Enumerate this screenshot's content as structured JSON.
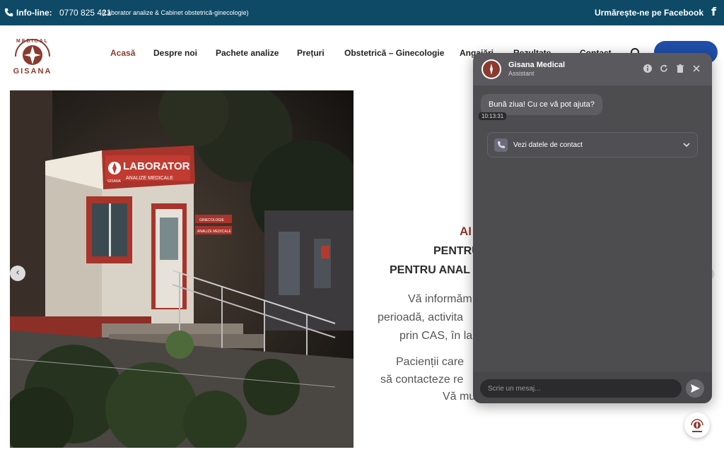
{
  "topbar": {
    "info_label": "Info-line:",
    "phone": "0770 825 421",
    "description": "(Laborator analize & Cabinet obstetrică-ginecologie)",
    "follow": "Urmărește-ne pe Facebook",
    "fb_glyph": "f"
  },
  "logo": {
    "top_text": "MEDICAL",
    "brand": "GISANA"
  },
  "nav": {
    "home": "Acasă",
    "about": "Despre noi",
    "packages": "Pachete analize",
    "prices": "Prețuri",
    "obstetrics": "Obstetrică – Ginecologie",
    "jobs": "Angajări",
    "results": "Rezultate",
    "contact": "Contact"
  },
  "hero": {
    "sign_main": "LABORATOR",
    "sign_sub": "ANALIZE MEDICALE",
    "sign_brand": "GISANA",
    "door_sign_1": "GINECOLOGIE",
    "door_sign_2": "ANALIZE MEDICALE",
    "arrow_left": "‹",
    "line1": "AI",
    "line2": "PENTRU",
    "line3": "PENTRU ANAL",
    "line4": "Vă informăm",
    "line5": "perioadă, activita",
    "line6": "prin CAS, în la",
    "line7": "Pacienții care",
    "line8": "să contacteze re",
    "line9": "Vă mu"
  },
  "chat": {
    "name": "Gisana Medical",
    "role": "Assistant",
    "greeting": "Bună ziua! Cu ce vă pot ajuta?",
    "time": "10:13:31",
    "contact_card": "Vezi datele de contact",
    "input_placeholder": "Scrie un mesaj..."
  },
  "colors": {
    "topbar": "#0e4a66",
    "brand": "#8b3a2e",
    "cart": "#1f4fa8"
  }
}
